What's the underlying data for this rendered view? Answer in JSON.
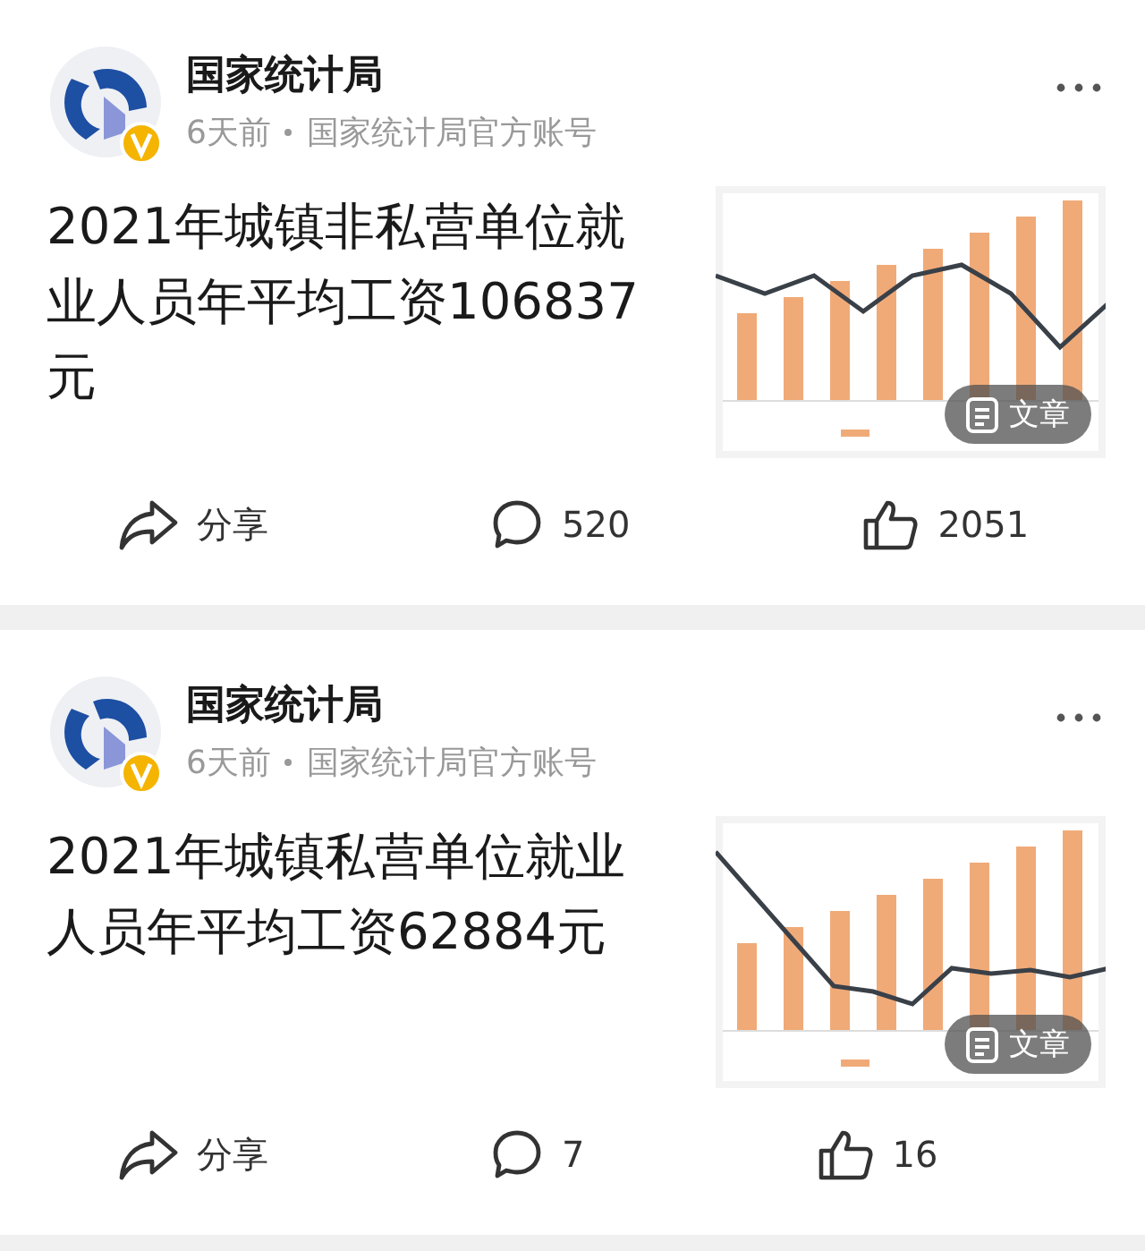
{
  "posts": [
    {
      "author": "国家统计局",
      "time": "6天前",
      "source": "国家统计局官方账号",
      "title": "2021年城镇非私营单位就业人员年平均工资106837元",
      "thumbnail": {
        "kind": "picture",
        "badge": "文章"
      },
      "actions": [
        {
          "kind": "share",
          "label": "分享"
        },
        {
          "kind": "comment",
          "label": "520"
        },
        {
          "kind": "like",
          "label": "2051"
        }
      ]
    },
    {
      "author": "国家统计局",
      "time": "6天前",
      "source": "国家统计局官方账号",
      "title": "2021年城镇私营单位就业人员年平均工资62884元",
      "thumbnail": {
        "kind": "picture",
        "badge": "文章"
      },
      "actions": [
        {
          "kind": "share",
          "label": "分享"
        },
        {
          "kind": "comment",
          "label": "7"
        },
        {
          "kind": "like",
          "label": "16"
        }
      ]
    }
  ]
}
